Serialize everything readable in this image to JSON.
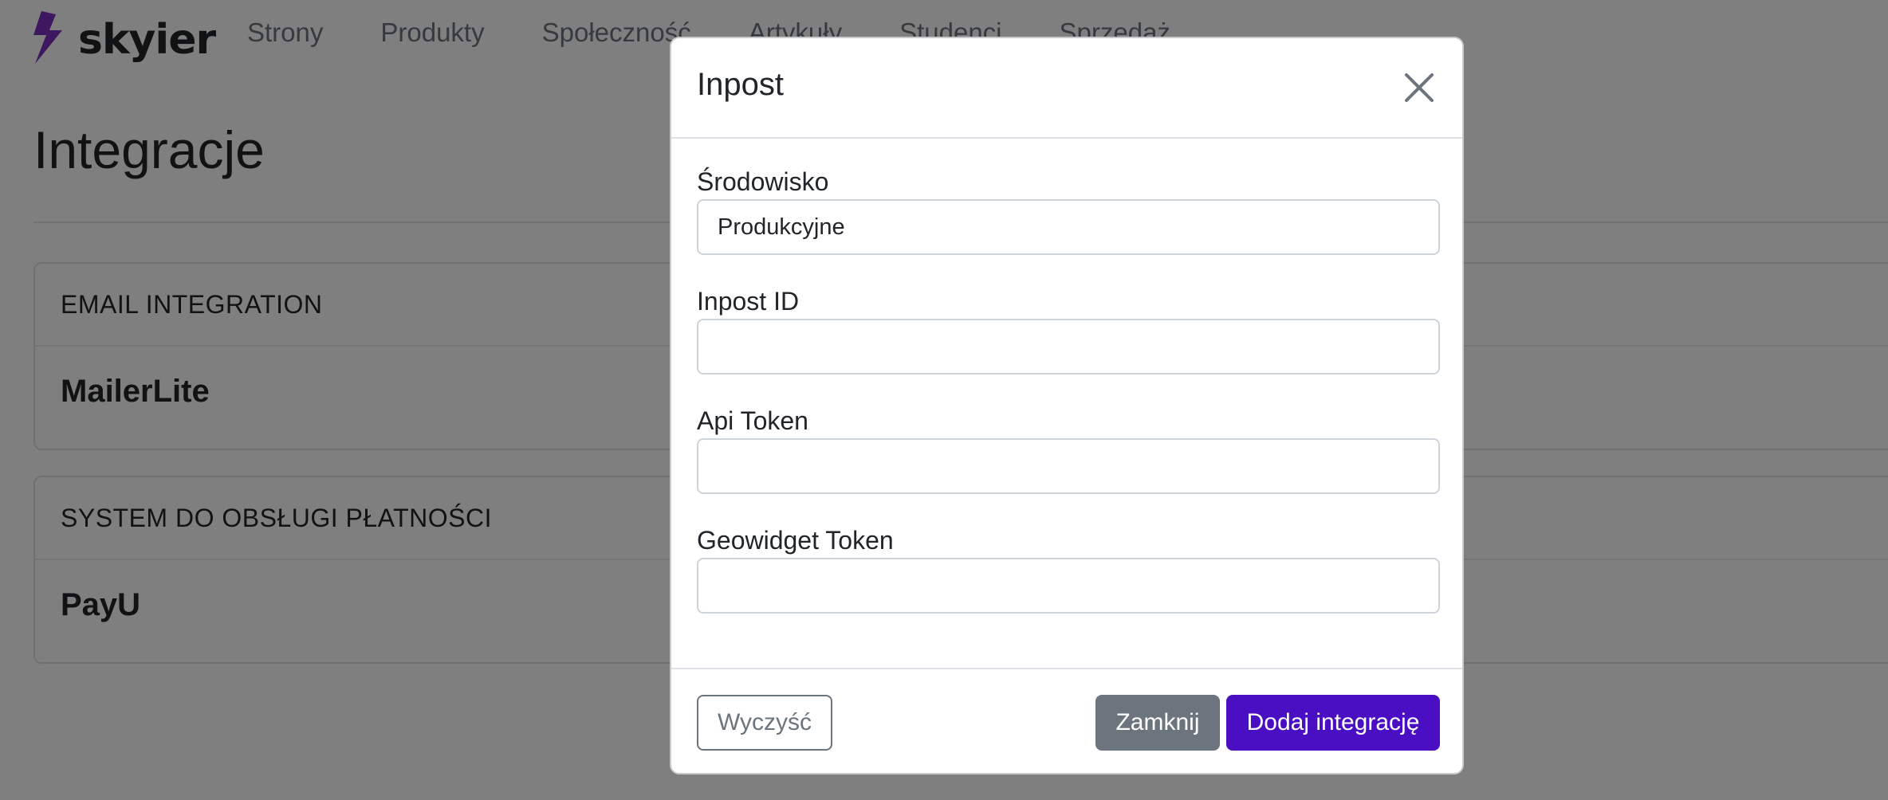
{
  "brand": {
    "name": "skyier",
    "logo_icon": "lightning-bolt-icon",
    "accent": "#7b2fbf"
  },
  "nav": {
    "items": [
      "Strony",
      "Produkty",
      "Społeczność",
      "Artykuły",
      "Studenci",
      "Sprzedaż"
    ]
  },
  "page": {
    "title": "Integracje"
  },
  "cards": [
    {
      "category": "EMAIL INTEGRATION",
      "name": "MailerLite"
    },
    {
      "category": "SYSTEM DO OBSŁUGI PŁATNOŚCI",
      "name": "PayU"
    }
  ],
  "modal": {
    "title": "Inpost",
    "close_icon": "close-icon",
    "fields": [
      {
        "label": "Środowisko",
        "value": "Produkcyjne",
        "placeholder": ""
      },
      {
        "label": "Inpost ID",
        "value": "",
        "placeholder": ""
      },
      {
        "label": "Api Token",
        "value": "",
        "placeholder": ""
      },
      {
        "label": "Geowidget Token",
        "value": "",
        "placeholder": ""
      }
    ],
    "buttons": {
      "clear": "Wyczyść",
      "close": "Zamknij",
      "add": "Dodaj integrację"
    }
  },
  "colors": {
    "primary": "#4a0fc2",
    "secondary": "#6c757d",
    "backdrop": "rgba(0,0,0,0.5)"
  }
}
